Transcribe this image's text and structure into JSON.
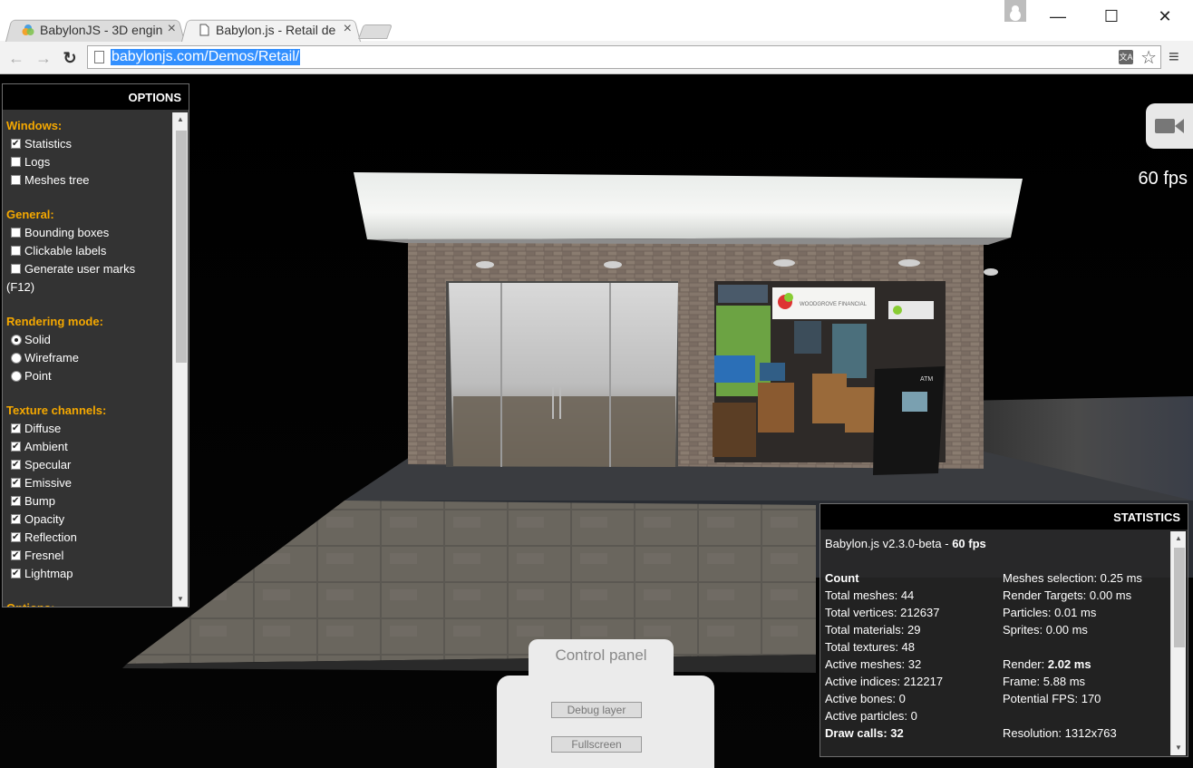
{
  "browser": {
    "tabs": [
      {
        "title": "BabylonJS - 3D engin",
        "active": false
      },
      {
        "title": "Babylon.js - Retail de",
        "active": true
      }
    ],
    "address": "babylonjs.com/Demos/Retail/",
    "window_controls": {
      "minimize": "—",
      "maximize": "☐",
      "close": "✕"
    },
    "nav": {
      "back": "←",
      "forward": "→",
      "reload": "↻"
    }
  },
  "scene": {
    "fps": "60 fps",
    "store_sign": "WOODGROVE FINANCIAL",
    "atm_label": "ATM"
  },
  "options": {
    "header": "OPTIONS",
    "windows_label": "Windows:",
    "windows": [
      {
        "label": "Statistics",
        "checked": true
      },
      {
        "label": "Logs",
        "checked": false
      },
      {
        "label": "Meshes tree",
        "checked": false
      }
    ],
    "general_label": "General:",
    "general": [
      {
        "label": "Bounding boxes",
        "checked": false
      },
      {
        "label": "Clickable labels",
        "checked": false
      },
      {
        "label": "Generate user marks",
        "checked": false
      }
    ],
    "general_note": "(F12)",
    "rendering_label": "Rendering mode:",
    "rendering": [
      {
        "label": "Solid",
        "checked": true
      },
      {
        "label": "Wireframe",
        "checked": false
      },
      {
        "label": "Point",
        "checked": false
      }
    ],
    "texture_label": "Texture channels:",
    "texture": [
      {
        "label": "Diffuse",
        "checked": true
      },
      {
        "label": "Ambient",
        "checked": true
      },
      {
        "label": "Specular",
        "checked": true
      },
      {
        "label": "Emissive",
        "checked": true
      },
      {
        "label": "Bump",
        "checked": true
      },
      {
        "label": "Opacity",
        "checked": true
      },
      {
        "label": "Reflection",
        "checked": true
      },
      {
        "label": "Fresnel",
        "checked": true
      },
      {
        "label": "Lightmap",
        "checked": true
      }
    ],
    "options_label": "Options:"
  },
  "stats": {
    "header": "STATISTICS",
    "version": "Babylon.js v2.3.0-beta - ",
    "version_fps": "60 fps",
    "left": [
      {
        "label": "Count",
        "value": "",
        "bold": true
      },
      {
        "label": "Total meshes: ",
        "value": "44"
      },
      {
        "label": "Total vertices: ",
        "value": "212637"
      },
      {
        "label": "Total materials: ",
        "value": "29"
      },
      {
        "label": "Total textures: ",
        "value": "48"
      },
      {
        "label": "Active meshes: ",
        "value": "32"
      },
      {
        "label": "Active indices: ",
        "value": "212217"
      },
      {
        "label": "Active bones: ",
        "value": "0"
      },
      {
        "label": "Active particles: ",
        "value": "0"
      },
      {
        "label": "Draw calls: ",
        "value": "32",
        "bold": true
      }
    ],
    "right": [
      {
        "label": "Meshes selection: ",
        "value": "0.25 ms"
      },
      {
        "label": "Render Targets: ",
        "value": "0.00 ms"
      },
      {
        "label": "Particles: ",
        "value": "0.01 ms"
      },
      {
        "label": "Sprites: ",
        "value": "0.00 ms"
      },
      {
        "label": "",
        "value": ""
      },
      {
        "label": "Render: ",
        "value": "2.02 ms",
        "bold_value": true
      },
      {
        "label": "Frame: ",
        "value": "5.88 ms"
      },
      {
        "label": "Potential FPS: ",
        "value": "170"
      },
      {
        "label": "",
        "value": ""
      },
      {
        "label": "Resolution: ",
        "value": "1312x763"
      }
    ]
  },
  "control_panel": {
    "title": "Control panel",
    "debug_button": "Debug layer",
    "fullscreen_button": "Fullscreen"
  }
}
